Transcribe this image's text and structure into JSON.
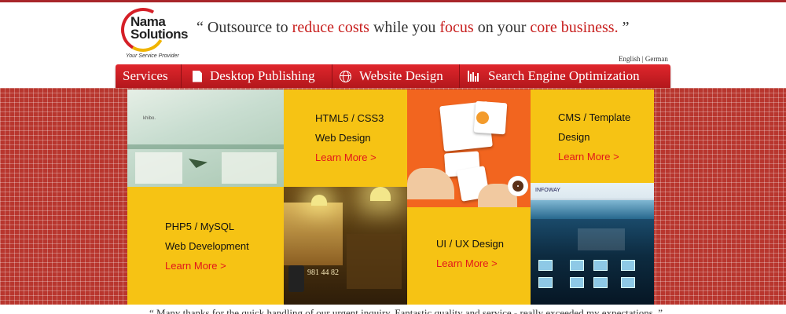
{
  "header": {
    "logo_line1": "Nama",
    "logo_line2": "Solutions",
    "logo_tagline": "Your Service Provider",
    "tagline": {
      "q_open": "“",
      "p1": " Outsource to ",
      "h1": "reduce costs",
      "p2": " while you ",
      "h2": "focus",
      "p3": " on your ",
      "h3": "core business.",
      "q_close": "  ”"
    },
    "lang": {
      "english": "English",
      "sep": " | ",
      "german": "German"
    }
  },
  "nav": {
    "items": [
      {
        "label": "Services"
      },
      {
        "label": "Desktop Publishing",
        "icon": "document-icon"
      },
      {
        "label": "Website  Design",
        "icon": "globe-icon"
      },
      {
        "label": "Search Engine Optimization",
        "icon": "bar-chart-icon"
      }
    ]
  },
  "tiles": {
    "html5": {
      "line1": "HTML5 / CSS3",
      "line2": "Web Design",
      "learn": "Learn More  >"
    },
    "cms": {
      "line1": "CMS / Template",
      "line2": "Design",
      "learn": "Learn More  >"
    },
    "php": {
      "line1": "PHP5 / MySQL",
      "line2": "Web Development",
      "learn": "Learn More  >"
    },
    "uiux": {
      "line1": "UI / UX Design",
      "learn": "Learn More  >"
    }
  },
  "images": {
    "img1_logo": "khibo.",
    "img2_number": "981 44 82",
    "img4_logo": "INFOWAY"
  },
  "colors": {
    "accent_red": "#c8201f",
    "nav_red": "#d11f24",
    "tile_yellow": "#f6c314",
    "learn_more": "#e2161b"
  },
  "testimonial": "“ Many thanks for the quick handling of our urgent inquiry. Fantastic quality and service - really exceeded my expectations. ”"
}
